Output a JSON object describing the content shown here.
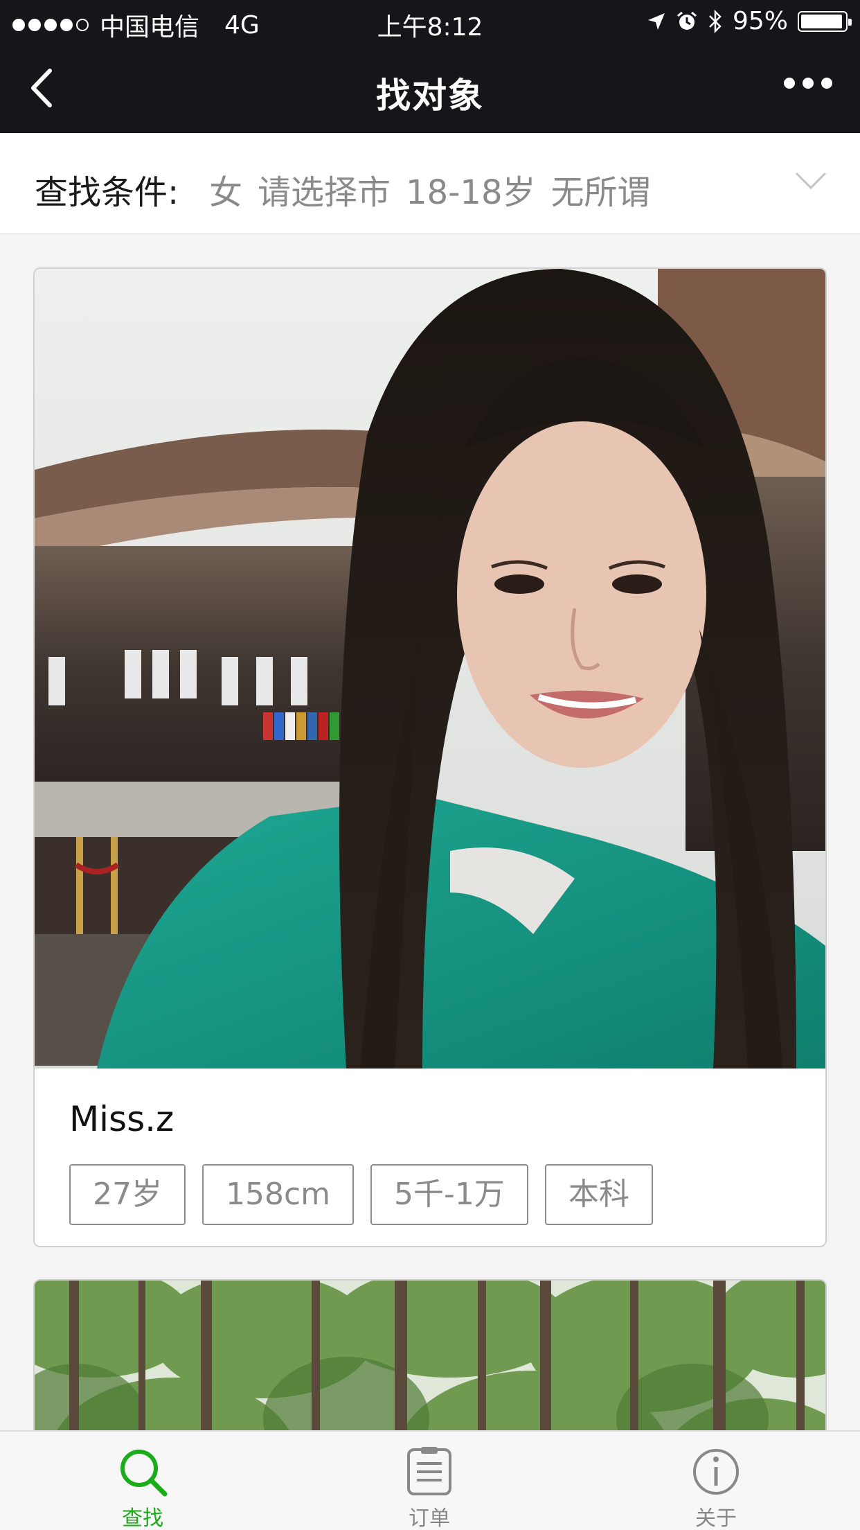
{
  "status_bar": {
    "carrier": "中国电信",
    "network": "4G",
    "time": "上午8:12",
    "battery": "95%",
    "battery_level": 0.95,
    "icons": [
      "location-arrow-icon",
      "alarm-icon",
      "bluetooth-icon",
      "battery-icon"
    ]
  },
  "nav": {
    "title": "找对象",
    "back_icon": "chevron-left-icon",
    "more_icon": "more-dots-icon"
  },
  "filter": {
    "label": "查找条件:",
    "gender": "女",
    "city": "请选择市",
    "age": "18-18岁",
    "other": "无所谓",
    "expand_icon": "chevron-down-icon"
  },
  "profiles": [
    {
      "name": "Miss.z",
      "photo": "woman-selfie-photo",
      "tags": [
        "27岁",
        "158cm",
        "5千-1万",
        "本科"
      ]
    },
    {
      "photo": "forest-photo"
    }
  ],
  "tabbar": {
    "items": [
      {
        "label": "查找",
        "icon": "search-icon",
        "active": true
      },
      {
        "label": "订单",
        "icon": "clipboard-icon",
        "active": false
      },
      {
        "label": "关于",
        "icon": "info-icon",
        "active": false
      }
    ],
    "active_color": "#1aad19",
    "inactive_color": "#888888"
  },
  "colors": {
    "header_bg": "#16151a",
    "accent": "#1aad19"
  }
}
